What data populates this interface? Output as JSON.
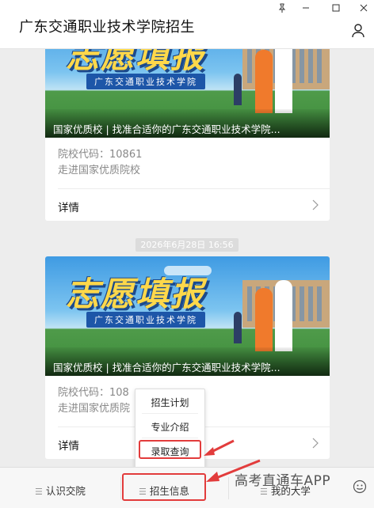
{
  "window": {
    "title": "广东交通职业技术学院招生",
    "controls": [
      "pin-icon",
      "minimize-icon",
      "maximize-icon",
      "close-icon"
    ]
  },
  "cards": [
    {
      "banner_title": "志愿填报",
      "banner_subtitle": "广东交通职业技术学院",
      "caption": "国家优质校 | 找准合适你的广东交通职业技术学院...",
      "code_line": "院校代码：10861",
      "slogan": "走进国家优质院校",
      "detail_label": "详情"
    },
    {
      "banner_title": "志愿填报",
      "banner_subtitle": "广东交通职业技术学院",
      "caption": "国家优质校 | 找准合适你的广东交通职业技术学院...",
      "code_line": "院校代码：108",
      "slogan": "走进国家优质院",
      "detail_label": "详情"
    }
  ],
  "timestamp": "2026年6月28日 16:56",
  "popup_menu": {
    "items": [
      "招生计划",
      "专业介绍",
      "录取查询"
    ],
    "highlighted": "录取查询"
  },
  "bottom_tabs": [
    {
      "label": "认识交院"
    },
    {
      "label": "招生信息",
      "highlighted": true
    },
    {
      "label": "我的大学"
    }
  ],
  "watermark": "高考直通车APP",
  "colors": {
    "highlight": "#e23c3c",
    "banner_yellow": "#ffd84a",
    "banner_blue": "#1d56a8"
  }
}
